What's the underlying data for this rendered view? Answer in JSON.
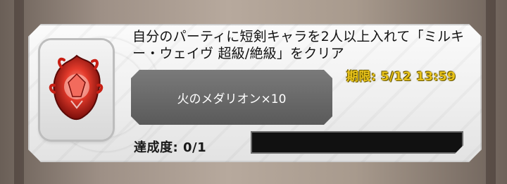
{
  "mission": {
    "title": "自分のパーティに短剣キャラを2人以上入れて「ミルキー・ウェイヴ 超級/絶級」をクリア",
    "deadline": "期限: 5/12 13:59",
    "reward": "火のメダリオン×10",
    "progress_label": "達成度: 0/1",
    "progress_value": 0
  },
  "icon": {
    "name": "fire-medallion-icon"
  },
  "colors": {
    "deadline_text": "#e8c21a",
    "reward_plate": "#666666",
    "progress_track": "#111111"
  }
}
